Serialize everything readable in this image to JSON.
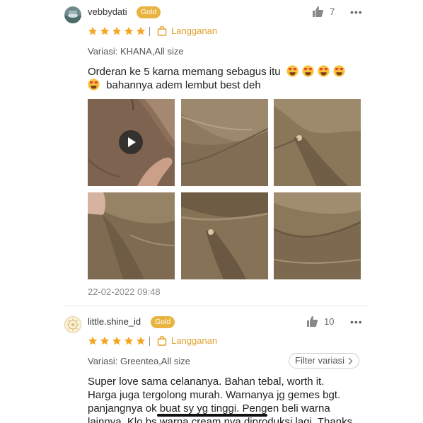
{
  "reviews": [
    {
      "username": "vebbydati",
      "badge": "Gold",
      "likes": "7",
      "rating": 5,
      "subscription_label": "Langganan",
      "variant": "Variasi: KHANA,All size",
      "text_line1": "Orderan ke 5 karna memang sebagus itu",
      "text_line2": "bahannya adem lembut best deh",
      "date": "22-02-2022 09:48",
      "photos": [
        "video-thumbnail",
        "fabric-photo",
        "fabric-photo",
        "fabric-photo",
        "fabric-photo",
        "fabric-photo"
      ]
    },
    {
      "username": "little.shine_id",
      "badge": "Gold",
      "likes": "10",
      "rating": 5,
      "subscription_label": "Langganan",
      "variant": "Variasi: Greentea,All size",
      "filter_label": "Filter variasi",
      "text_lines": [
        "Super love sama celananya. Bahan tebal, worth it.",
        "Harga juga tergolong murah. Warnanya jg gemes bgt.",
        "panjangnya ok buat sy yg tinggi. Pengen beli warna",
        "lainnya. Klo bs warna cream nya diproduksi lagi. Thanks"
      ]
    }
  ],
  "colors": {
    "star": "#f5a623",
    "badge": "#e8b33f",
    "subscription": "#e0a12e",
    "fabric": "#8e7a5f"
  },
  "icons": [
    "thumbs-up-icon",
    "more-dots-icon",
    "star-icon",
    "bag-icon",
    "play-icon",
    "heart-eyes-emoji",
    "chevron-right-icon"
  ]
}
